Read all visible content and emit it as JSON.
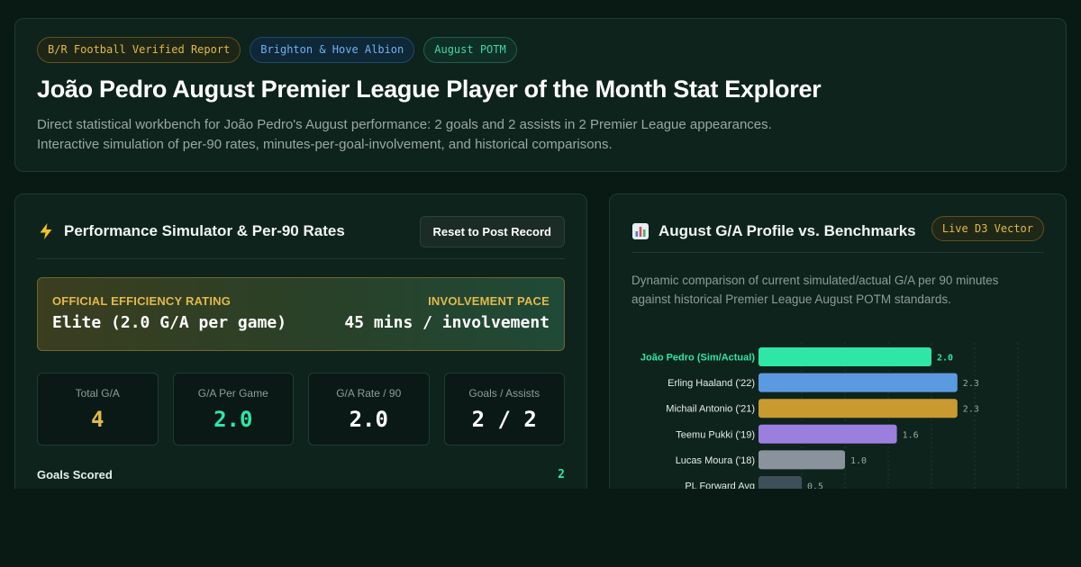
{
  "header": {
    "badges": [
      "B/R Football Verified Report",
      "Brighton & Hove Albion",
      "August POTM"
    ],
    "title": "João Pedro August Premier League Player of the Month Stat Explorer",
    "description_line1": "Direct statistical workbench for João Pedro's August performance: 2 goals and 2 assists in 2 Premier League appearances.",
    "description_line2": "Interactive simulation of per-90 rates, minutes-per-goal-involvement, and historical comparisons."
  },
  "simulator": {
    "icon": "lightning-bolt-icon",
    "title": "Performance Simulator & Per-90 Rates",
    "reset_label": "Reset to Post Record",
    "rating_label": "OFFICIAL EFFICIENCY RATING",
    "rating_value": "Elite (2.0 G/A per game)",
    "pace_label": "INVOLVEMENT PACE",
    "pace_value": "45 mins / involvement",
    "stats": [
      {
        "label": "Total G/A",
        "value": "4",
        "color": "#e2b94a"
      },
      {
        "label": "G/A Per Game",
        "value": "2.0",
        "color": "#2ee6a6"
      },
      {
        "label": "G/A Rate / 90",
        "value": "2.0",
        "color": "#ffffff"
      },
      {
        "label": "Goals / Assists",
        "value": "2 / 2",
        "color": "#ffffff"
      }
    ],
    "goals_label": "Goals Scored",
    "goals_value": "2"
  },
  "benchmark": {
    "icon": "bar-chart-icon",
    "title": "August G/A Profile vs. Benchmarks",
    "live_badge": "Live D3 Vector",
    "description": "Dynamic comparison of current simulated/actual G/A per 90 minutes against historical Premier League August POTM standards."
  },
  "chart_data": {
    "type": "bar",
    "orientation": "horizontal",
    "categories": [
      "João Pedro (Sim/Actual)",
      "Erling Haaland ('22)",
      "Michail Antonio ('21)",
      "Teemu Pukki ('19)",
      "Lucas Moura ('18)",
      "PL Forward Avg"
    ],
    "values": [
      2.0,
      2.3,
      2.3,
      1.6,
      1.0,
      0.5
    ],
    "value_labels": [
      "2.0",
      "2.3",
      "2.3",
      "1.6",
      "1.0",
      "0.5"
    ],
    "colors": [
      "#2ee6a6",
      "#5b9ae0",
      "#c99a30",
      "#9b7fdf",
      "#8a939c",
      "#3e4f5a"
    ],
    "xlim": [
      0,
      3.0
    ],
    "grid": true
  }
}
